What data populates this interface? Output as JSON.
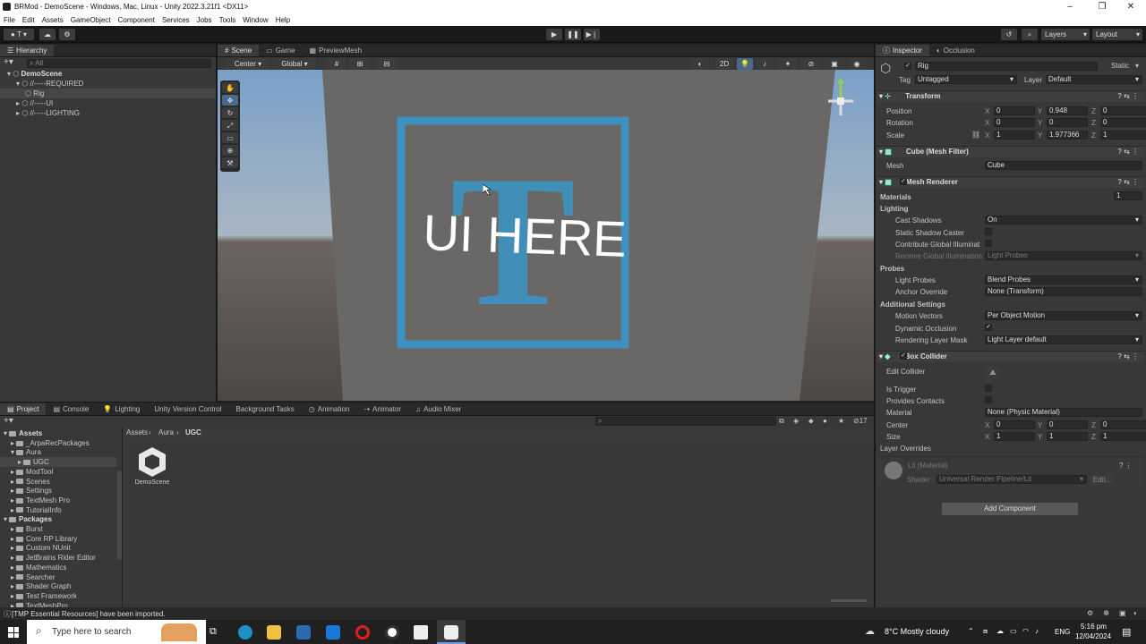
{
  "window": {
    "title": "BRMod - DemoScene - Windows, Mac, Linux - Unity 2022.3.21f1 <DX11>"
  },
  "menu": [
    "File",
    "Edit",
    "Assets",
    "GameObject",
    "Component",
    "Services",
    "Jobs",
    "Tools",
    "Window",
    "Help"
  ],
  "toolbar": {
    "account": "T",
    "layers": "Layers",
    "layout": "Layout"
  },
  "hierarchy": {
    "tab": "Hierarchy",
    "search": "All",
    "items": [
      {
        "label": "DemoScene",
        "depth": 0
      },
      {
        "label": "//-----REQUIRED",
        "depth": 1
      },
      {
        "label": "Rig",
        "depth": 2
      },
      {
        "label": "//-----UI",
        "depth": 1
      },
      {
        "label": "//-----LIGHTING",
        "depth": 1
      }
    ]
  },
  "scene": {
    "tabs": [
      "Scene",
      "Game",
      "PreviewMesh"
    ],
    "pivot": "Center",
    "space": "Global",
    "mode2d": "2D",
    "overlay_text": "UI HERE",
    "logo_letter": "T"
  },
  "inspector": {
    "tabs": [
      "Inspector",
      "Occlusion"
    ],
    "object": {
      "name": "Rig",
      "static": "Static",
      "tag_label": "Tag",
      "tag": "Untagged",
      "layer_label": "Layer",
      "layer": "Default"
    },
    "transform": {
      "title": "Transform",
      "position_label": "Position",
      "rotation_label": "Rotation",
      "scale_label": "Scale",
      "position": [
        "0",
        "0.948",
        "0"
      ],
      "rotation": [
        "0",
        "0",
        "0"
      ],
      "scale": [
        "1",
        "1.977366",
        "1"
      ]
    },
    "mesh_filter": {
      "title": "Cube (Mesh Filter)",
      "mesh_label": "Mesh",
      "mesh": "Cube"
    },
    "mesh_renderer": {
      "title": "Mesh Renderer",
      "materials_label": "Materials",
      "materials_count": "1",
      "lighting": "Lighting",
      "cast_shadows_label": "Cast Shadows",
      "cast_shadows": "On",
      "static_shadow_caster": "Static Shadow Caster",
      "contribute_gi": "Contribute Global Illuminat",
      "receive_gi_label": "Receive Global Illumination",
      "receive_gi": "Light Probes",
      "probes": "Probes",
      "light_probes_label": "Light Probes",
      "light_probes": "Blend Probes",
      "anchor_override_label": "Anchor Override",
      "anchor_override": "None (Transform)",
      "additional": "Additional Settings",
      "motion_vectors_label": "Motion Vectors",
      "motion_vectors": "Per Object Motion",
      "dynamic_occlusion": "Dynamic Occlusion",
      "rendering_layer_label": "Rendering Layer Mask",
      "rendering_layer": "Light Layer default"
    },
    "box_collider": {
      "title": "Box Collider",
      "edit_collider": "Edit Collider",
      "is_trigger": "Is Trigger",
      "provides_contacts": "Provides Contacts",
      "material_label": "Material",
      "material": "None (Physic Material)",
      "center_label": "Center",
      "size_label": "Size",
      "center": [
        "0",
        "0",
        "0"
      ],
      "size": [
        "1",
        "1",
        "1"
      ],
      "layer_overrides": "Layer Overrides"
    },
    "material": {
      "name": "Lit (Material)",
      "shader_label": "Shader",
      "shader": "Universal Render Pipeline/Lit",
      "edit": "Edit..."
    },
    "add_component": "Add Component",
    "axes": [
      "X",
      "Y",
      "Z"
    ]
  },
  "bottom": {
    "tabs": [
      "Project",
      "Console",
      "Lighting",
      "Unity Version Control",
      "Background Tasks",
      "Animation",
      "Animator",
      "Audio Mixer"
    ],
    "breadcrumb": [
      "Assets",
      "Aura",
      "UGC"
    ],
    "hidden_count": "17",
    "tree": [
      {
        "label": "Assets",
        "depth": 0,
        "bold": true
      },
      {
        "label": "_ArpaRecPackages",
        "depth": 1
      },
      {
        "label": "Aura",
        "depth": 1
      },
      {
        "label": "UGC",
        "depth": 2
      },
      {
        "label": "ModTool",
        "depth": 1
      },
      {
        "label": "Scenes",
        "depth": 1
      },
      {
        "label": "Settings",
        "depth": 1
      },
      {
        "label": "TextMesh Pro",
        "depth": 1
      },
      {
        "label": "TutorialInfo",
        "depth": 1
      },
      {
        "label": "Packages",
        "depth": 0,
        "bold": true
      },
      {
        "label": "Burst",
        "depth": 1
      },
      {
        "label": "Core RP Library",
        "depth": 1
      },
      {
        "label": "Custom NUnit",
        "depth": 1
      },
      {
        "label": "JetBrains Rider Editor",
        "depth": 1
      },
      {
        "label": "Mathematics",
        "depth": 1
      },
      {
        "label": "Searcher",
        "depth": 1
      },
      {
        "label": "Shader Graph",
        "depth": 1
      },
      {
        "label": "Test Framework",
        "depth": 1
      },
      {
        "label": "TextMeshPro",
        "depth": 1
      }
    ],
    "asset": "DemoScene"
  },
  "status": {
    "message": "[TMP Essential Resources] have been imported."
  },
  "taskbar": {
    "search": "Type here to search",
    "weather": "8°C  Mostly cloudy",
    "lang": "ENG",
    "time": "5:16 pm",
    "date": "12/04/2024"
  },
  "colors": {
    "accent": "#3a96c8",
    "unity_bg": "#383838"
  }
}
